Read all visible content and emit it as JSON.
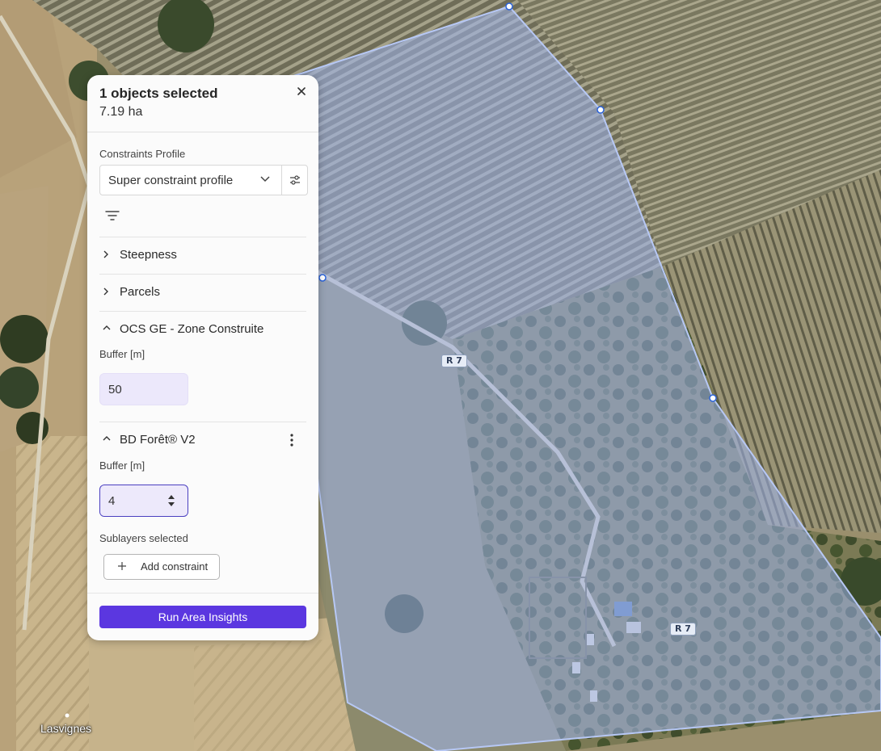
{
  "map": {
    "road_labels": [
      "R 7",
      "R 7"
    ],
    "place_label": "Lasvignes",
    "colors": {
      "selection_fill": "#9fb4ee",
      "selection_stroke": "#b7c8f5",
      "vertex": "#2b63d9"
    }
  },
  "panel": {
    "title": "1 objects selected",
    "area": "7.19 ha",
    "close_icon": "close-icon",
    "constraints_profile_label": "Constraints Profile",
    "profile_select_value": "Super constraint profile",
    "sections": [
      {
        "label": "Steepness",
        "expanded": false
      },
      {
        "label": "Parcels",
        "expanded": false
      },
      {
        "label": "OCS GE - Zone Construite",
        "expanded": true,
        "buffer_label": "Buffer [m]",
        "buffer_value": "50"
      },
      {
        "label": "BD Forêt® V2",
        "expanded": true,
        "buffer_label": "Buffer [m]",
        "buffer_value": "4"
      }
    ],
    "sublayers_label": "Sublayers selected",
    "add_constraint_label": "Add constraint",
    "run_button_label": "Run Area Insights",
    "colors": {
      "accent": "#5b37e0",
      "input_bg": "#ece8fb",
      "input_active_border": "#4a3fc0"
    }
  }
}
